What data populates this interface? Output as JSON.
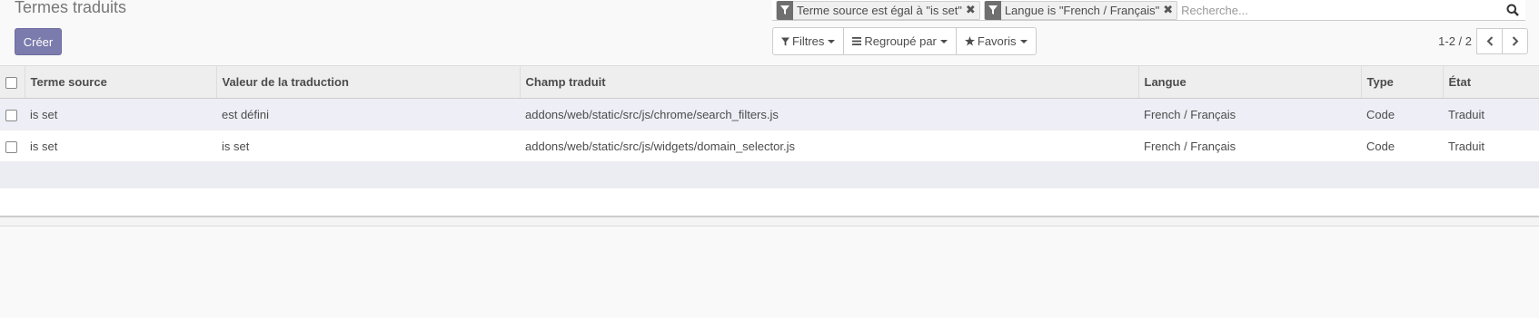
{
  "breadcrumb": "Termes traduits",
  "buttons": {
    "create": "Créer"
  },
  "search": {
    "facets": [
      {
        "label": "Terme source est égal à \"is set\""
      },
      {
        "label": "Langue is \"French / Français\""
      }
    ],
    "placeholder": "Recherche..."
  },
  "dropdowns": {
    "filters": "Filtres",
    "group_by": "Regroupé par",
    "favorites": "Favoris"
  },
  "pager": {
    "value": "1-2 / 2"
  },
  "table": {
    "columns": [
      "Terme source",
      "Valeur de la traduction",
      "Champ traduit",
      "Langue",
      "Type",
      "État"
    ],
    "rows": [
      [
        "is set",
        "est défini",
        "addons/web/static/src/js/chrome/search_filters.js",
        "French / Français",
        "Code",
        "Traduit"
      ],
      [
        "is set",
        "is set",
        "addons/web/static/src/js/widgets/domain_selector.js",
        "French / Français",
        "Code",
        "Traduit"
      ]
    ]
  },
  "icons": {
    "filter": "filter-icon",
    "remove": "close-icon",
    "search": "magnifier-icon",
    "bars": "bars-icon",
    "star": "star-icon",
    "prev": "chevron-left-icon",
    "next": "chevron-right-icon"
  },
  "colors": {
    "primary": "#7c7bad",
    "header_bg": "#eeeeee",
    "odd_row": "#eeeef6",
    "facet_label": "#6f6f6f"
  }
}
